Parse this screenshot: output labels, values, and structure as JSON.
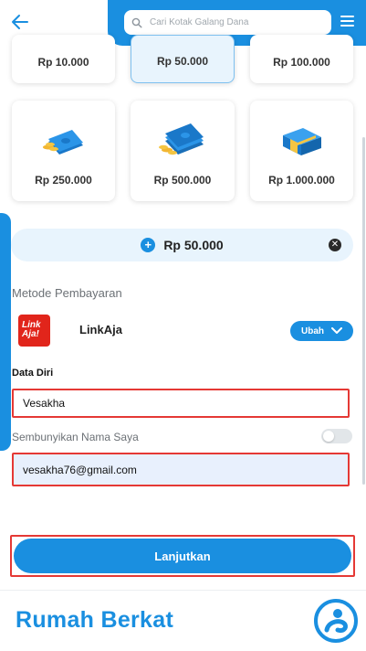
{
  "header": {
    "back_icon": "arrow-left-icon",
    "search_placeholder": "Cari Kotak Galang Dana",
    "menu_icon": "hamburger-menu-icon"
  },
  "cards": [
    {
      "label": "Rp 10.000",
      "selected": false
    },
    {
      "label": "Rp 50.000",
      "selected": true
    },
    {
      "label": "Rp 100.000",
      "selected": false
    },
    {
      "label": "Rp 250.000",
      "selected": false
    },
    {
      "label": "Rp 500.000",
      "selected": false
    },
    {
      "label": "Rp 1.000.000",
      "selected": false
    }
  ],
  "amount": {
    "value": "Rp 50.000"
  },
  "payment": {
    "title": "Metode Pembayaran",
    "logo_text": "Link Aja!",
    "method": "LinkAja",
    "change_label": "Ubah"
  },
  "personal": {
    "title": "Data Diri",
    "name_value": "Vesakha",
    "hide_name_label": "Sembunyikan Nama Saya",
    "hide_name_on": false,
    "email_value": "vesakha76@gmail.com"
  },
  "submit": {
    "label": "Lanjutkan"
  },
  "footer": {
    "brand": "Rumah Berkat"
  },
  "colors": {
    "primary": "#1a8fe0",
    "highlight_border": "#e53935",
    "selected_card": "#e8f4fd"
  }
}
